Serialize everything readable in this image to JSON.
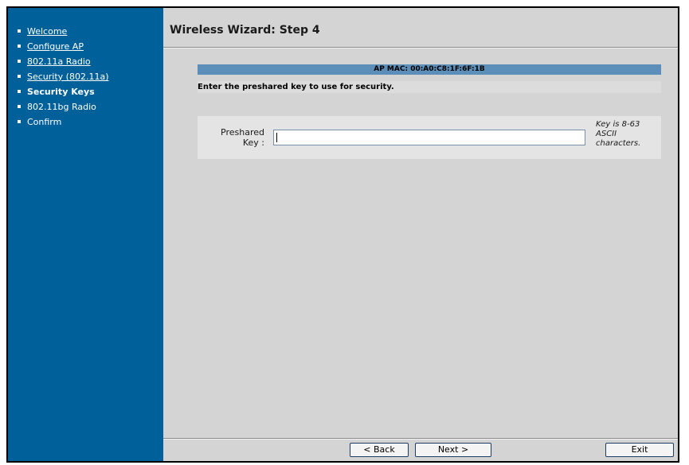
{
  "sidebar": {
    "items": [
      {
        "label": "Welcome"
      },
      {
        "label": "Configure AP"
      },
      {
        "label": "802.11a Radio"
      },
      {
        "label": "Security (802.11a)"
      },
      {
        "label": "Security Keys"
      },
      {
        "label": "802.11bg Radio"
      },
      {
        "label": "Confirm"
      }
    ]
  },
  "header": {
    "title": "Wireless Wizard: Step 4"
  },
  "content": {
    "mac_label": "AP MAC: 00:A0:C8:1F:6F:1B",
    "instruction": "Enter the preshared key to use for security.",
    "field": {
      "label_line1": "Preshared",
      "label_line2": "Key :",
      "value": "",
      "hint": "Key is 8-63 ASCII characters."
    }
  },
  "footer": {
    "back_label": "< Back",
    "next_label": "Next >",
    "exit_label": "Exit"
  },
  "colors": {
    "sidebar_bg": "#00609a",
    "content_bg": "#d4d4d4",
    "mac_bar_bg": "#5b8fba"
  }
}
